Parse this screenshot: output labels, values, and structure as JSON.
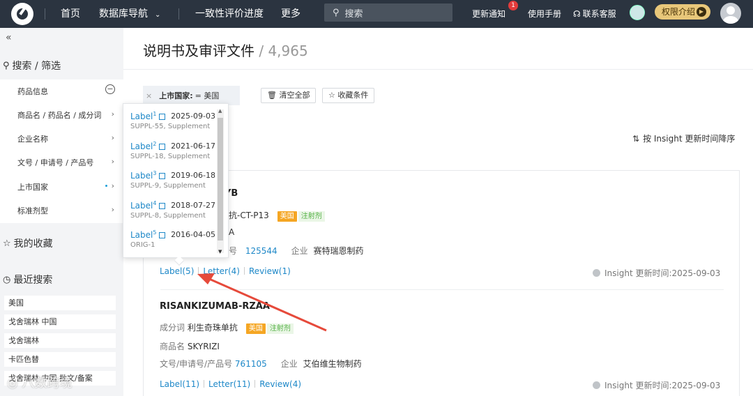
{
  "topbar": {
    "nav": [
      "首页",
      "数据库导航",
      "一致性评价进度",
      "更多"
    ],
    "search_placeholder": "搜索",
    "update_notice": "更新通知",
    "update_badge": "1",
    "manual": "使用手册",
    "support": "联系客服",
    "permission": "权限介绍"
  },
  "sidebar": {
    "collapse": "«",
    "search_title": "搜索 / 筛选",
    "filters": [
      {
        "label": "药品信息"
      },
      {
        "label": "商品名 / 药品名 / 成分词"
      },
      {
        "label": "企业名称"
      },
      {
        "label": "文号 / 申请号 / 产品号"
      },
      {
        "label": "上市国家"
      },
      {
        "label": "标准剂型"
      }
    ],
    "favorites_title": "我的收藏",
    "recent_title": "最近搜索",
    "recent": [
      "美国",
      "戈舍瑞林 中国",
      "戈舍瑞林",
      "卡匹色替",
      "戈舍瑞林 中国 批文/备案"
    ]
  },
  "main": {
    "title": "说明书及审评文件",
    "count": "/ 4,965",
    "filter_chip_key": "上市国家:",
    "filter_chip_value": "= 美国",
    "clear_all": "清空全部",
    "save_filter": "收藏条件",
    "sort": "按 Insight 更新时间降序",
    "results": [
      {
        "name": "YB",
        "ingredient_tail": "单抗-CT-P13",
        "country_tag": "美国",
        "form_tag": "注射剂",
        "product_tail": "A",
        "number_label_tail": "号",
        "number": "125544",
        "company_label": "企业",
        "company": "赛特瑞恩制药",
        "links": [
          "Label(5)",
          "Letter(4)",
          "Review(1)"
        ],
        "updated": "Insight 更新时间:2025-09-03"
      },
      {
        "name": "RISANKIZUMAB-RZAA",
        "ingredient_label": "成分词",
        "ingredient": "利生奇珠单抗",
        "country_tag": "美国",
        "form_tag": "注射剂",
        "product_label": "商品名",
        "product": "SKYRIZI",
        "number_label": "文号/申请号/产品号",
        "number": "761105",
        "company_label": "企业",
        "company": "艾伯维生物制药",
        "links": [
          "Label(11)",
          "Letter(11)",
          "Review(4)"
        ],
        "updated": "Insight 更新时间:2025-09-03"
      }
    ]
  },
  "popover": {
    "items": [
      {
        "label": "Label",
        "sup": "1",
        "date": "2025-09-03",
        "sub": "SUPPL-55, Supplement"
      },
      {
        "label": "Label",
        "sup": "2",
        "date": "2021-06-17",
        "sub": "SUPPL-18, Supplement"
      },
      {
        "label": "Label",
        "sup": "3",
        "date": "2019-06-18",
        "sub": "SUPPL-9, Supplement"
      },
      {
        "label": "Label",
        "sup": "4",
        "date": "2018-07-27",
        "sub": "SUPPL-8, Supplement"
      },
      {
        "label": "Label",
        "sup": "5",
        "date": "2016-04-05",
        "sub": "ORIG-1"
      }
    ]
  },
  "watermark": "八数跨境",
  "colors": {
    "topbar": "#2b3440",
    "accent": "#1e88c8",
    "tag_orange": "#f5a623",
    "tag_green": "#52b043",
    "arrow": "#e64a3b"
  }
}
